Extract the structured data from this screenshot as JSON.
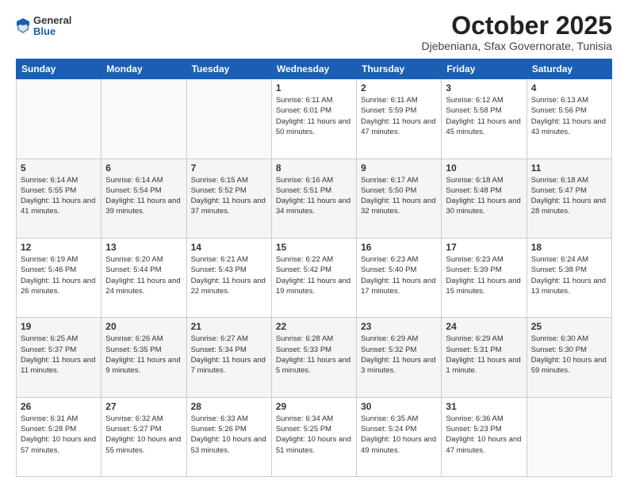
{
  "header": {
    "logo": {
      "general": "General",
      "blue": "Blue"
    },
    "title": "October 2025",
    "location": "Djebeniana, Sfax Governorate, Tunisia"
  },
  "weekdays": [
    "Sunday",
    "Monday",
    "Tuesday",
    "Wednesday",
    "Thursday",
    "Friday",
    "Saturday"
  ],
  "weeks": [
    [
      {
        "day": "",
        "info": ""
      },
      {
        "day": "",
        "info": ""
      },
      {
        "day": "",
        "info": ""
      },
      {
        "day": "1",
        "info": "Sunrise: 6:11 AM\nSunset: 6:01 PM\nDaylight: 11 hours and 50 minutes."
      },
      {
        "day": "2",
        "info": "Sunrise: 6:11 AM\nSunset: 5:59 PM\nDaylight: 11 hours and 47 minutes."
      },
      {
        "day": "3",
        "info": "Sunrise: 6:12 AM\nSunset: 5:58 PM\nDaylight: 11 hours and 45 minutes."
      },
      {
        "day": "4",
        "info": "Sunrise: 6:13 AM\nSunset: 5:56 PM\nDaylight: 11 hours and 43 minutes."
      }
    ],
    [
      {
        "day": "5",
        "info": "Sunrise: 6:14 AM\nSunset: 5:55 PM\nDaylight: 11 hours and 41 minutes."
      },
      {
        "day": "6",
        "info": "Sunrise: 6:14 AM\nSunset: 5:54 PM\nDaylight: 11 hours and 39 minutes."
      },
      {
        "day": "7",
        "info": "Sunrise: 6:15 AM\nSunset: 5:52 PM\nDaylight: 11 hours and 37 minutes."
      },
      {
        "day": "8",
        "info": "Sunrise: 6:16 AM\nSunset: 5:51 PM\nDaylight: 11 hours and 34 minutes."
      },
      {
        "day": "9",
        "info": "Sunrise: 6:17 AM\nSunset: 5:50 PM\nDaylight: 11 hours and 32 minutes."
      },
      {
        "day": "10",
        "info": "Sunrise: 6:18 AM\nSunset: 5:48 PM\nDaylight: 11 hours and 30 minutes."
      },
      {
        "day": "11",
        "info": "Sunrise: 6:18 AM\nSunset: 5:47 PM\nDaylight: 11 hours and 28 minutes."
      }
    ],
    [
      {
        "day": "12",
        "info": "Sunrise: 6:19 AM\nSunset: 5:46 PM\nDaylight: 11 hours and 26 minutes."
      },
      {
        "day": "13",
        "info": "Sunrise: 6:20 AM\nSunset: 5:44 PM\nDaylight: 11 hours and 24 minutes."
      },
      {
        "day": "14",
        "info": "Sunrise: 6:21 AM\nSunset: 5:43 PM\nDaylight: 11 hours and 22 minutes."
      },
      {
        "day": "15",
        "info": "Sunrise: 6:22 AM\nSunset: 5:42 PM\nDaylight: 11 hours and 19 minutes."
      },
      {
        "day": "16",
        "info": "Sunrise: 6:23 AM\nSunset: 5:40 PM\nDaylight: 11 hours and 17 minutes."
      },
      {
        "day": "17",
        "info": "Sunrise: 6:23 AM\nSunset: 5:39 PM\nDaylight: 11 hours and 15 minutes."
      },
      {
        "day": "18",
        "info": "Sunrise: 6:24 AM\nSunset: 5:38 PM\nDaylight: 11 hours and 13 minutes."
      }
    ],
    [
      {
        "day": "19",
        "info": "Sunrise: 6:25 AM\nSunset: 5:37 PM\nDaylight: 11 hours and 11 minutes."
      },
      {
        "day": "20",
        "info": "Sunrise: 6:26 AM\nSunset: 5:35 PM\nDaylight: 11 hours and 9 minutes."
      },
      {
        "day": "21",
        "info": "Sunrise: 6:27 AM\nSunset: 5:34 PM\nDaylight: 11 hours and 7 minutes."
      },
      {
        "day": "22",
        "info": "Sunrise: 6:28 AM\nSunset: 5:33 PM\nDaylight: 11 hours and 5 minutes."
      },
      {
        "day": "23",
        "info": "Sunrise: 6:29 AM\nSunset: 5:32 PM\nDaylight: 11 hours and 3 minutes."
      },
      {
        "day": "24",
        "info": "Sunrise: 6:29 AM\nSunset: 5:31 PM\nDaylight: 11 hours and 1 minute."
      },
      {
        "day": "25",
        "info": "Sunrise: 6:30 AM\nSunset: 5:30 PM\nDaylight: 10 hours and 59 minutes."
      }
    ],
    [
      {
        "day": "26",
        "info": "Sunrise: 6:31 AM\nSunset: 5:28 PM\nDaylight: 10 hours and 57 minutes."
      },
      {
        "day": "27",
        "info": "Sunrise: 6:32 AM\nSunset: 5:27 PM\nDaylight: 10 hours and 55 minutes."
      },
      {
        "day": "28",
        "info": "Sunrise: 6:33 AM\nSunset: 5:26 PM\nDaylight: 10 hours and 53 minutes."
      },
      {
        "day": "29",
        "info": "Sunrise: 6:34 AM\nSunset: 5:25 PM\nDaylight: 10 hours and 51 minutes."
      },
      {
        "day": "30",
        "info": "Sunrise: 6:35 AM\nSunset: 5:24 PM\nDaylight: 10 hours and 49 minutes."
      },
      {
        "day": "31",
        "info": "Sunrise: 6:36 AM\nSunset: 5:23 PM\nDaylight: 10 hours and 47 minutes."
      },
      {
        "day": "",
        "info": ""
      }
    ]
  ]
}
